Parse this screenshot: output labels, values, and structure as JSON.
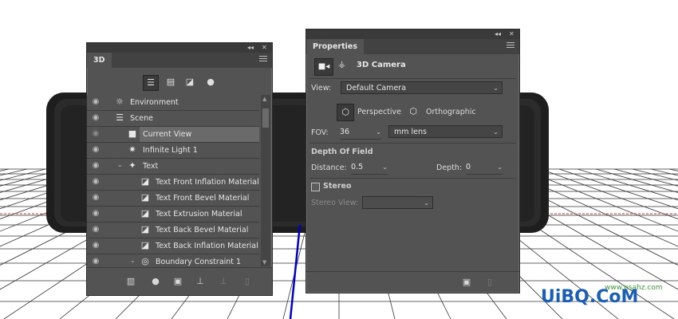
{
  "panel3d": {
    "tab": "3D",
    "collapse_icon": "double-chevron-icon",
    "close_icon": "close-icon",
    "filters": [
      {
        "name": "whole-scene-filter-icon",
        "glyph": "☰",
        "selected": true
      },
      {
        "name": "meshes-filter-icon",
        "glyph": "▤",
        "selected": false
      },
      {
        "name": "materials-filter-icon",
        "glyph": "◪",
        "selected": false
      },
      {
        "name": "lights-filter-icon",
        "glyph": "●",
        "selected": false
      }
    ],
    "layers": [
      {
        "label": "Environment",
        "icon": "environment-icon",
        "glyph": "☼",
        "visible": true
      },
      {
        "label": "Scene",
        "icon": "scene-icon",
        "glyph": "☰",
        "visible": true
      },
      {
        "label": "Current View",
        "icon": "camera-icon",
        "glyph": "■",
        "visible": false,
        "selected": true
      },
      {
        "label": "Infinite Light 1",
        "icon": "light-icon",
        "glyph": "✷",
        "visible": true
      },
      {
        "label": "Text",
        "icon": "mesh-icon",
        "glyph": "✦",
        "visible": true,
        "expanded": true
      },
      {
        "label": "Text Front Inflation Material",
        "icon": "material-icon",
        "glyph": "◪",
        "visible": true
      },
      {
        "label": "Text Front Bevel Material",
        "icon": "material-icon",
        "glyph": "◪",
        "visible": true
      },
      {
        "label": "Text Extrusion Material",
        "icon": "material-icon",
        "glyph": "◪",
        "visible": true
      },
      {
        "label": "Text Back Bevel Material",
        "icon": "material-icon",
        "glyph": "◪",
        "visible": true
      },
      {
        "label": "Text Back Inflation Material",
        "icon": "material-icon",
        "glyph": "◪",
        "visible": true
      },
      {
        "label": "Boundary Constraint 1",
        "icon": "constraint-icon",
        "glyph": "◎",
        "visible": true,
        "expanded": true
      }
    ],
    "bottom_buttons": [
      {
        "name": "render-icon",
        "glyph": "▥"
      },
      {
        "name": "add-light-icon",
        "glyph": "●"
      },
      {
        "name": "add-mesh-icon",
        "glyph": "▣"
      },
      {
        "name": "drop-to-ground-icon",
        "glyph": "⊥"
      },
      {
        "name": "new-constraint-icon",
        "glyph": "⊥"
      },
      {
        "name": "trash-icon",
        "glyph": "▯"
      }
    ]
  },
  "properties": {
    "tab": "Properties",
    "collapse_icon": "double-chevron-icon",
    "close_icon": "close-icon",
    "header_title": "3D Camera",
    "view_label": "View:",
    "view_value": "Default Camera",
    "perspective_label": "Perspective",
    "orthographic_label": "Orthographic",
    "fov_label": "FOV:",
    "fov_value": "36",
    "fov_unit": "mm lens",
    "dof_title": "Depth Of Field",
    "distance_label": "Distance:",
    "distance_value": "0.5",
    "depth_label": "Depth:",
    "depth_value": "0",
    "stereo_label": "Stereo",
    "stereo_checked": false,
    "stereo_view_label": "Stereo View:",
    "stereo_view_value": ""
  },
  "watermark": {
    "text": "UiBQ.CoM",
    "sub": "www.psahz.com"
  }
}
